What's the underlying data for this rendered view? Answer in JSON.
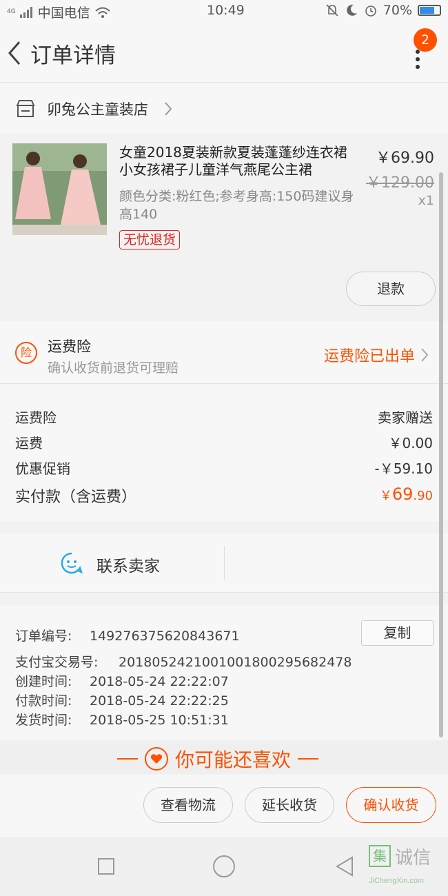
{
  "status_bar": {
    "network": "4G",
    "carrier": "中国电信",
    "time": "10:49",
    "battery": "70%",
    "battery_level": 0.7
  },
  "header": {
    "title": "订单详情",
    "badge_count": "2",
    "icons": [
      "back-icon",
      "more-icon"
    ]
  },
  "shop": {
    "name": "卯兔公主童装店",
    "icon": "shop-icon"
  },
  "product": {
    "title": "女童2018夏装新款夏装蓬蓬纱连衣裙小女孩裙子儿童洋气燕尾公主裙",
    "sku": "颜色分类:粉红色;参考身高:150码建议身高140",
    "tag": "无忧退货",
    "price": "￥69.90",
    "original_price": "￥129.00",
    "quantity": "x1",
    "refund_label": "退款"
  },
  "insurance": {
    "icon_text": "险",
    "title": "运费险",
    "subtitle": "确认收货前退货可理赔",
    "status": "运费险已出单"
  },
  "fees": [
    {
      "label": "运费险",
      "value": "卖家赠送"
    },
    {
      "label": "运费",
      "value": "￥0.00"
    },
    {
      "label": "优惠促销",
      "value": "-￥59.10"
    }
  ],
  "paid": {
    "label": "实付款（含运费）",
    "currency": "￥",
    "integer": "69",
    "decimal": ".90"
  },
  "contact": {
    "label": "联系卖家",
    "icon": "chat-icon"
  },
  "order_info": {
    "order_no_label": "订单编号:",
    "order_no": "149276375620843671",
    "copy_label": "复制",
    "alipay_label": "支付宝交易号:",
    "alipay_no": "2018052421001001800295682478",
    "created_label": "创建时间:",
    "created": "2018-05-24 22:22:07",
    "paid_label": "付款时间:",
    "paid": "2018-05-24 22:22:25",
    "shipped_label": "发货时间:",
    "shipped": "2018-05-25 10:51:31"
  },
  "recommend": {
    "label": "你可能还喜欢"
  },
  "actions": {
    "logistics": "查看物流",
    "extend": "延长收货",
    "confirm": "确认收货"
  },
  "watermark": {
    "logo": "集",
    "text": "诚信",
    "url": "JiChengXin.com"
  },
  "colors": {
    "accent": "#ff5000",
    "tag_red": "#e0241c",
    "chat_blue": "#2aa7e8"
  }
}
